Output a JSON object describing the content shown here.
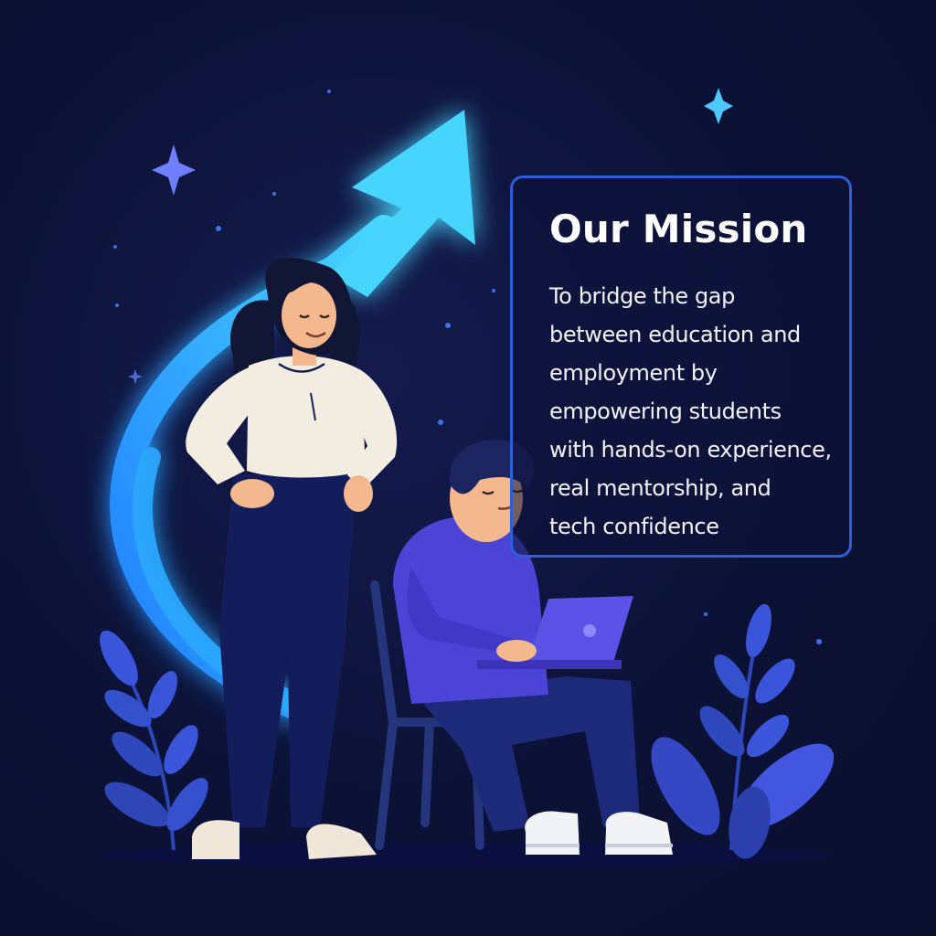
{
  "mission": {
    "title": "Our Mission",
    "body_lines": [
      "To bridge the gap",
      "between education and",
      "employment by",
      "empowering students",
      "with hands-on experience,",
      "real mentorship, and",
      "tech confidence"
    ]
  },
  "colors": {
    "background": "#0c1236",
    "arrow": "#3ec9ff",
    "card_border": "#2f5fd6",
    "text": "#ffffff",
    "plant": "#3a55d9"
  },
  "illustration": {
    "icons": [
      "growth-arrow-icon",
      "sparkle-star-icon",
      "woman-figure",
      "man-with-laptop-figure",
      "chair",
      "leaf-plant-icon"
    ]
  }
}
